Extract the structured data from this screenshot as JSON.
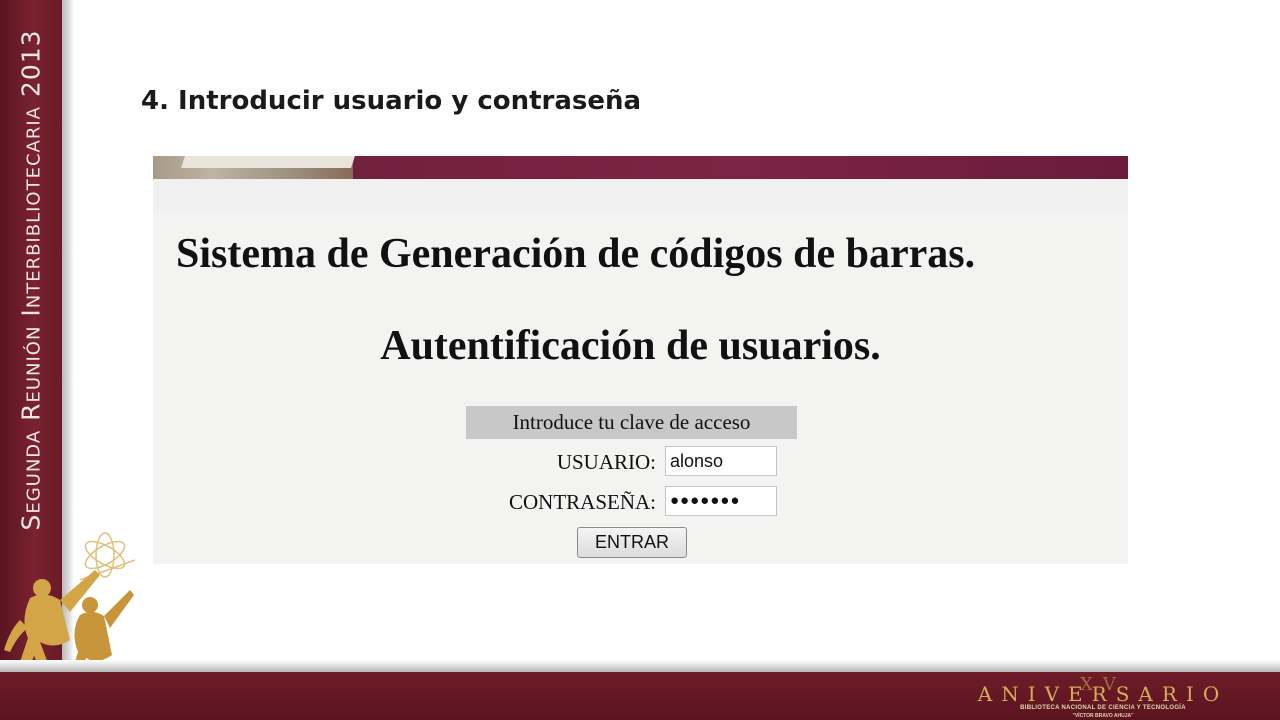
{
  "side_title": "Segunda Reunión Interbibliotecaria 2013",
  "slide_heading": "4. Introducir usuario y contraseña",
  "screenshot": {
    "system_title": "Sistema de Generación de códigos de barras.",
    "auth_title": "Autentificación de usuarios.",
    "form_header": "Introduce tu clave de acceso",
    "user_label": "USUARIO:",
    "user_value": "alonso",
    "password_label": "CONTRASEÑA:",
    "password_value": "●●●●●●●",
    "enter_label": "ENTRAR"
  },
  "anniversary": {
    "numeral": "XV",
    "word": "ANIVERSARIO",
    "line1": "BIBLIOTECA NACIONAL DE CIENCIA Y TECNOLOGÍA",
    "line2": "\"VÍCTOR BRAVO AHUJA\""
  },
  "colors": {
    "band": "#6e1c28",
    "gold": "#c9a24a",
    "banner": "#7c2443"
  }
}
